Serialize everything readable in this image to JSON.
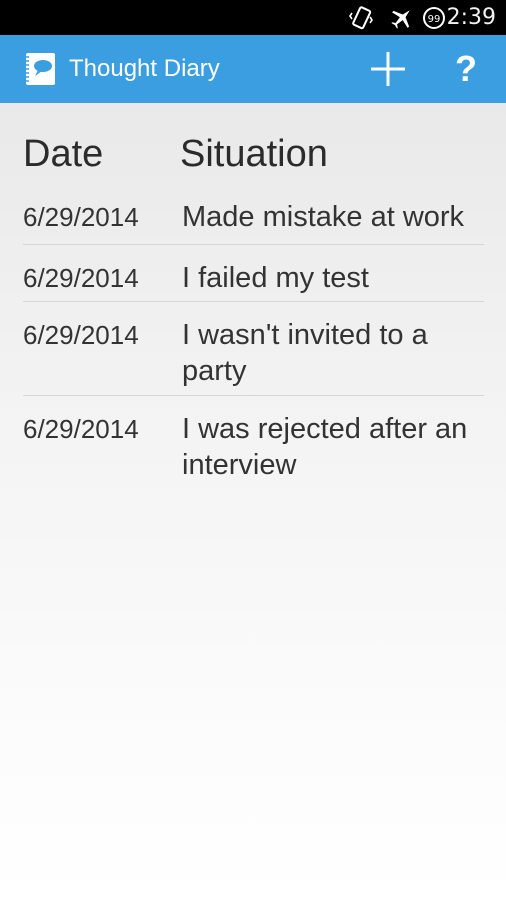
{
  "status_bar": {
    "time": "2:39",
    "icons": [
      "vibrate-icon",
      "airplane-mode-icon",
      "notification-count-icon"
    ],
    "notification_count": "99"
  },
  "action_bar": {
    "title": "Thought Diary",
    "app_icon": "notebook-chat-icon",
    "add_action_icon": "plus-icon",
    "help_action_label": "?",
    "background_color": "#3a9ee0"
  },
  "table": {
    "headers": {
      "date": "Date",
      "situation": "Situation"
    },
    "entries": [
      {
        "date": "6/29/2014",
        "situation": "Made mistake at work"
      },
      {
        "date": "6/29/2014",
        "situation": "I failed my test"
      },
      {
        "date": "6/29/2014",
        "situation": "I wasn't invited to a party"
      },
      {
        "date": "6/29/2014",
        "situation": "I was rejected after an interview"
      }
    ]
  }
}
